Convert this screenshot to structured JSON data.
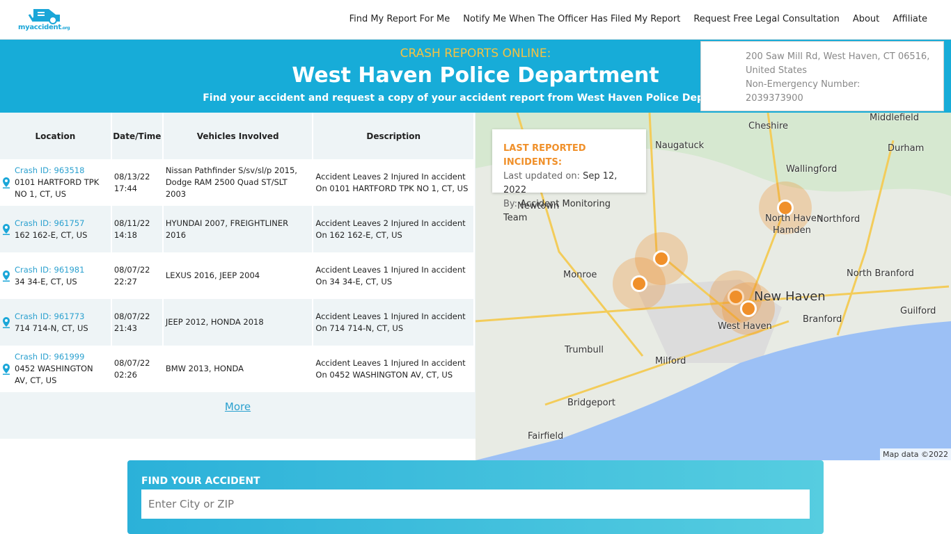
{
  "logo": {
    "text": "myaccident",
    "suffix": ".org"
  },
  "nav": [
    "Find My Report For Me",
    "Notify Me When The Officer Has Filed My Report",
    "Request Free Legal Consultation",
    "About",
    "Affiliate"
  ],
  "hero": {
    "kicker": "CRASH REPORTS ONLINE:",
    "title": "West Haven Police Department",
    "subtitle": "Find your accident and request a copy of your accident report from West Haven Police Department"
  },
  "address": {
    "line1": "200 Saw Mill Rd, West Haven, CT 06516,",
    "line2": "United States",
    "line3": "Non-Emergency Number:",
    "line4": "2039373900"
  },
  "table": {
    "headers": [
      "Location",
      "Date/Time",
      "Vehicles Involved",
      "Description"
    ],
    "rows": [
      {
        "crash_id": "Crash ID: 963518",
        "location": "0101 HARTFORD TPK NO 1, CT, US",
        "date": "08/13/22",
        "time": "17:44",
        "vehicles": "Nissan Pathfinder S/sv/sl/p 2015, Dodge RAM 2500 Quad ST/SLT 2003",
        "description": "Accident Leaves 2 Injured In accident On 0101 HARTFORD TPK NO 1, CT, US"
      },
      {
        "crash_id": "Crash ID: 961757",
        "location": "162 162-E, CT, US",
        "date": "08/11/22",
        "time": "14:18",
        "vehicles": "HYUNDAI 2007, FREIGHTLINER 2016",
        "description": "Accident Leaves 2 Injured In accident On 162 162-E, CT, US"
      },
      {
        "crash_id": "Crash ID: 961981",
        "location": "34 34-E, CT, US",
        "date": "08/07/22",
        "time": "22:27",
        "vehicles": "LEXUS 2016, JEEP 2004",
        "description": "Accident Leaves 1 Injured In accident On 34 34-E, CT, US"
      },
      {
        "crash_id": "Crash ID: 961773",
        "location": "714 714-N, CT, US",
        "date": "08/07/22",
        "time": "21:43",
        "vehicles": "JEEP 2012, HONDA 2018",
        "description": "Accident Leaves 1 Injured In accident On 714 714-N, CT, US"
      },
      {
        "crash_id": "Crash ID: 961999",
        "location": "0452 WASHINGTON AV, CT, US",
        "date": "08/07/22",
        "time": "02:26",
        "vehicles": "BMW 2013, HONDA",
        "description": "Accident Leaves 1 Injured In accident On 0452 WASHINGTON AV, CT, US"
      }
    ],
    "more": "More"
  },
  "map": {
    "info_title": "LAST REPORTED INCIDENTS:",
    "updated_label": "Last updated on:",
    "updated": "Sep 12, 2022",
    "by_label": "By:",
    "by": "Accident Monitoring Team",
    "labels": [
      "Cheshire",
      "Middlefield",
      "Naugatuck",
      "Durham",
      "Wallingford",
      "Newtown",
      "Hamden",
      "North Haven",
      "Northford",
      "Monroe",
      "New Haven",
      "North Branford",
      "West Haven",
      "Branford",
      "Guilford",
      "Trumbull",
      "Milford",
      "Bridgeport",
      "Fairfield"
    ],
    "attribution": "Map data ©2022",
    "accent": "#f0902a"
  },
  "find": {
    "label": "FIND YOUR ACCIDENT",
    "placeholder": "Enter City or ZIP"
  }
}
